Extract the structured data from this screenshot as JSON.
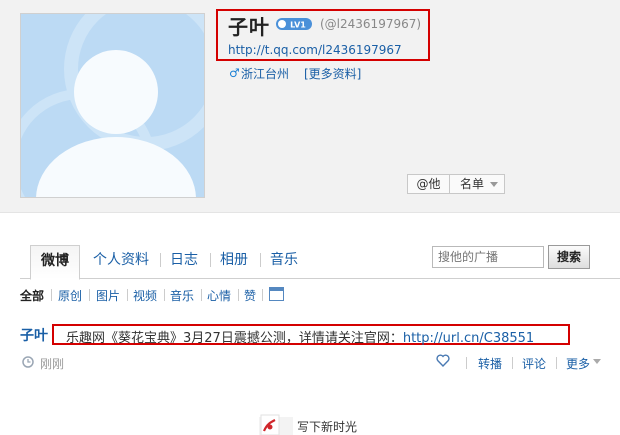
{
  "profile": {
    "name": "子叶",
    "level_badge": "LV1",
    "handle": "(@l2436197967)",
    "url": "http://t.qq.com/l2436197967",
    "gender_icon": "male-icon",
    "location": "浙江台州",
    "more_info": "[更多资料]",
    "at_button": "@他",
    "list_button": "名单"
  },
  "tabs": [
    {
      "label": "微博",
      "active": true
    },
    {
      "label": "个人资料",
      "active": false
    },
    {
      "label": "日志",
      "active": false
    },
    {
      "label": "相册",
      "active": false
    },
    {
      "label": "音乐",
      "active": false
    }
  ],
  "search": {
    "placeholder": "搜他的广播",
    "button": "搜索"
  },
  "filters": [
    {
      "label": "全部",
      "active": true
    },
    {
      "label": "原创",
      "active": false
    },
    {
      "label": "图片",
      "active": false
    },
    {
      "label": "视频",
      "active": false
    },
    {
      "label": "音乐",
      "active": false
    },
    {
      "label": "心情",
      "active": false
    },
    {
      "label": "赞",
      "active": false
    }
  ],
  "post": {
    "author": "子叶",
    "text": "乐趣网《葵花宝典》3月27日震撼公测，详情请关注官网：",
    "link": "http://url.cn/C38551",
    "time": "刚刚",
    "actions": {
      "repost": "转播",
      "comment": "评论",
      "more": "更多"
    }
  },
  "write_new": "写下新时光",
  "colors": {
    "link": "#1a5fa6",
    "highlight_box": "#d40000",
    "avatar_bg": "#bcdaf4"
  }
}
